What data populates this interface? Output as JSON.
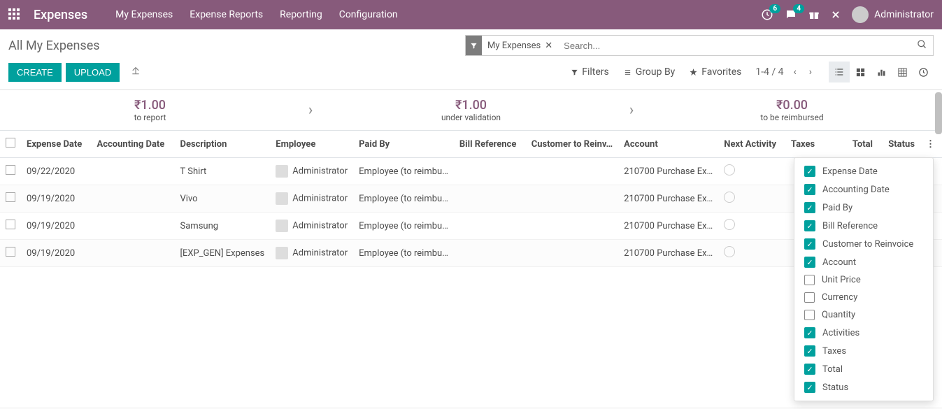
{
  "nav": {
    "brand": "Expenses",
    "items": [
      "My Expenses",
      "Expense Reports",
      "Reporting",
      "Configuration"
    ],
    "clock_badge": "6",
    "msg_badge": "4",
    "user": "Administrator"
  },
  "breadcrumb": "All My Expenses",
  "search": {
    "facet_label": "My Expenses",
    "placeholder": "Search..."
  },
  "buttons": {
    "create": "CREATE",
    "upload": "UPLOAD"
  },
  "search_opts": {
    "filters": "Filters",
    "groupby": "Group By",
    "favorites": "Favorites"
  },
  "pager": "1-4 / 4",
  "stats": [
    {
      "val": "₹1.00",
      "lbl": "to report"
    },
    {
      "val": "₹1.00",
      "lbl": "under validation"
    },
    {
      "val": "₹0.00",
      "lbl": "to be reimbursed"
    }
  ],
  "columns": [
    "",
    "Expense Date",
    "Accounting Date",
    "Description",
    "Employee",
    "Paid By",
    "Bill Reference",
    "Customer to Reinv…",
    "Account",
    "Next Activity",
    "Taxes",
    "Total",
    "Status",
    ""
  ],
  "rows": [
    {
      "date": "09/22/2020",
      "acc": "",
      "desc": "T Shirt",
      "emp": "Administrator",
      "paid": "Employee (to reimbu…",
      "bill": "",
      "cust": "",
      "account": "210700 Purchase Ex…"
    },
    {
      "date": "09/19/2020",
      "acc": "",
      "desc": "Vivo",
      "emp": "Administrator",
      "paid": "Employee (to reimbu…",
      "bill": "",
      "cust": "",
      "account": "210700 Purchase Ex…"
    },
    {
      "date": "09/19/2020",
      "acc": "",
      "desc": "Samsung",
      "emp": "Administrator",
      "paid": "Employee (to reimbu…",
      "bill": "",
      "cust": "",
      "account": "210700 Purchase Ex…"
    },
    {
      "date": "09/19/2020",
      "acc": "",
      "desc": "[EXP_GEN] Expenses",
      "emp": "Administrator",
      "paid": "Employee (to reimbu…",
      "bill": "",
      "cust": "",
      "account": "210700 Purchase Ex…"
    }
  ],
  "dropdown": [
    {
      "label": "Expense Date",
      "on": true
    },
    {
      "label": "Accounting Date",
      "on": true
    },
    {
      "label": "Paid By",
      "on": true
    },
    {
      "label": "Bill Reference",
      "on": true
    },
    {
      "label": "Customer to Reinvoice",
      "on": true
    },
    {
      "label": "Account",
      "on": true
    },
    {
      "label": "Unit Price",
      "on": false
    },
    {
      "label": "Currency",
      "on": false
    },
    {
      "label": "Quantity",
      "on": false
    },
    {
      "label": "Activities",
      "on": true
    },
    {
      "label": "Taxes",
      "on": true
    },
    {
      "label": "Total",
      "on": true
    },
    {
      "label": "Status",
      "on": true
    }
  ]
}
